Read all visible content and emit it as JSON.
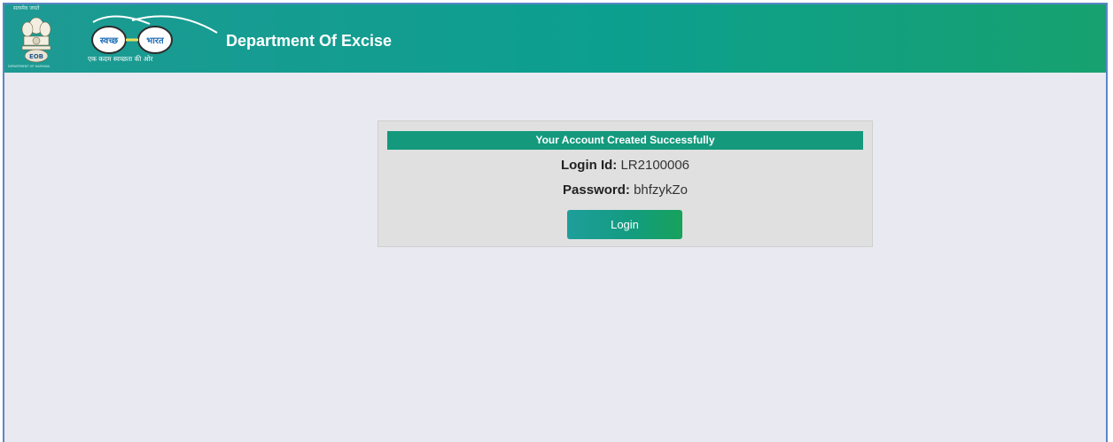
{
  "header": {
    "emblem_top_text": "सत्यमेव जयते",
    "emblem_bottom_text": "DEPARTMENT OF HARYANA",
    "swachh_left": "स्वच्छ",
    "swachh_right": "भारत",
    "swachh_tagline": "एक कदम स्वच्छता की ओर",
    "title": "Department Of Excise"
  },
  "card": {
    "banner": "Your Account Created Successfully",
    "login_id_label": "Login Id:",
    "login_id_value": "LR2100006",
    "password_label": "Password:",
    "password_value": "bhfzykZo",
    "login_button": "Login"
  },
  "colors": {
    "header_gradient": [
      "#1d9a93",
      "#0c9f8f",
      "#17a16f"
    ],
    "banner": "#14997d",
    "page_background": "#e9e9f1",
    "card_background": "#e0e0e0"
  },
  "icons": [
    "state-emblem-icon",
    "swachh-bharat-glasses-icon"
  ]
}
